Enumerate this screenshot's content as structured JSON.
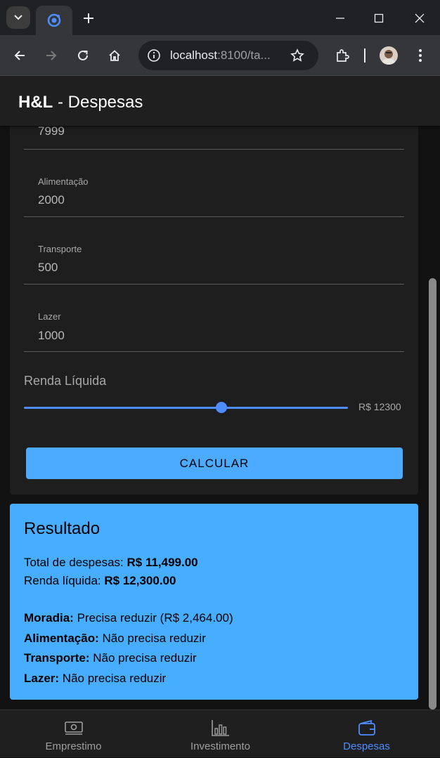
{
  "browser": {
    "url_host": "localhost",
    "url_rest": ":8100/ta..."
  },
  "app": {
    "title_bold": "H&L",
    "title_rest": " - Despesas"
  },
  "form": {
    "fields": [
      {
        "label": "",
        "value": "7999"
      },
      {
        "label": "Alimentação",
        "value": "2000"
      },
      {
        "label": "Transporte",
        "value": "500"
      },
      {
        "label": "Lazer",
        "value": "1000"
      }
    ],
    "range": {
      "label": "Renda Líquida",
      "value_text": "R$ 12300",
      "fraction": 0.61
    },
    "calculate_label": "CALCULAR"
  },
  "result": {
    "title": "Resultado",
    "total_label": "Total de despesas: ",
    "total_value": "R$ 11,499.00",
    "income_label": "Renda líquida: ",
    "income_value": "R$ 12,300.00",
    "items": [
      {
        "name": "Moradia:",
        "status": " Precisa reduzir (R$ 2,464.00)"
      },
      {
        "name": "Alimentação:",
        "status": " Não precisa reduzir"
      },
      {
        "name": "Transporte:",
        "status": " Não precisa reduzir"
      },
      {
        "name": "Lazer:",
        "status": " Não precisa reduzir"
      }
    ]
  },
  "tabs": [
    {
      "label": "Emprestimo",
      "icon": "cash-icon",
      "active": false
    },
    {
      "label": "Investimento",
      "icon": "bar-chart-icon",
      "active": false
    },
    {
      "label": "Despesas",
      "icon": "wallet-icon",
      "active": true
    }
  ],
  "colors": {
    "accent": "#4d8dff",
    "result_bg": "#47adfe",
    "button_bg": "#4dabff"
  }
}
